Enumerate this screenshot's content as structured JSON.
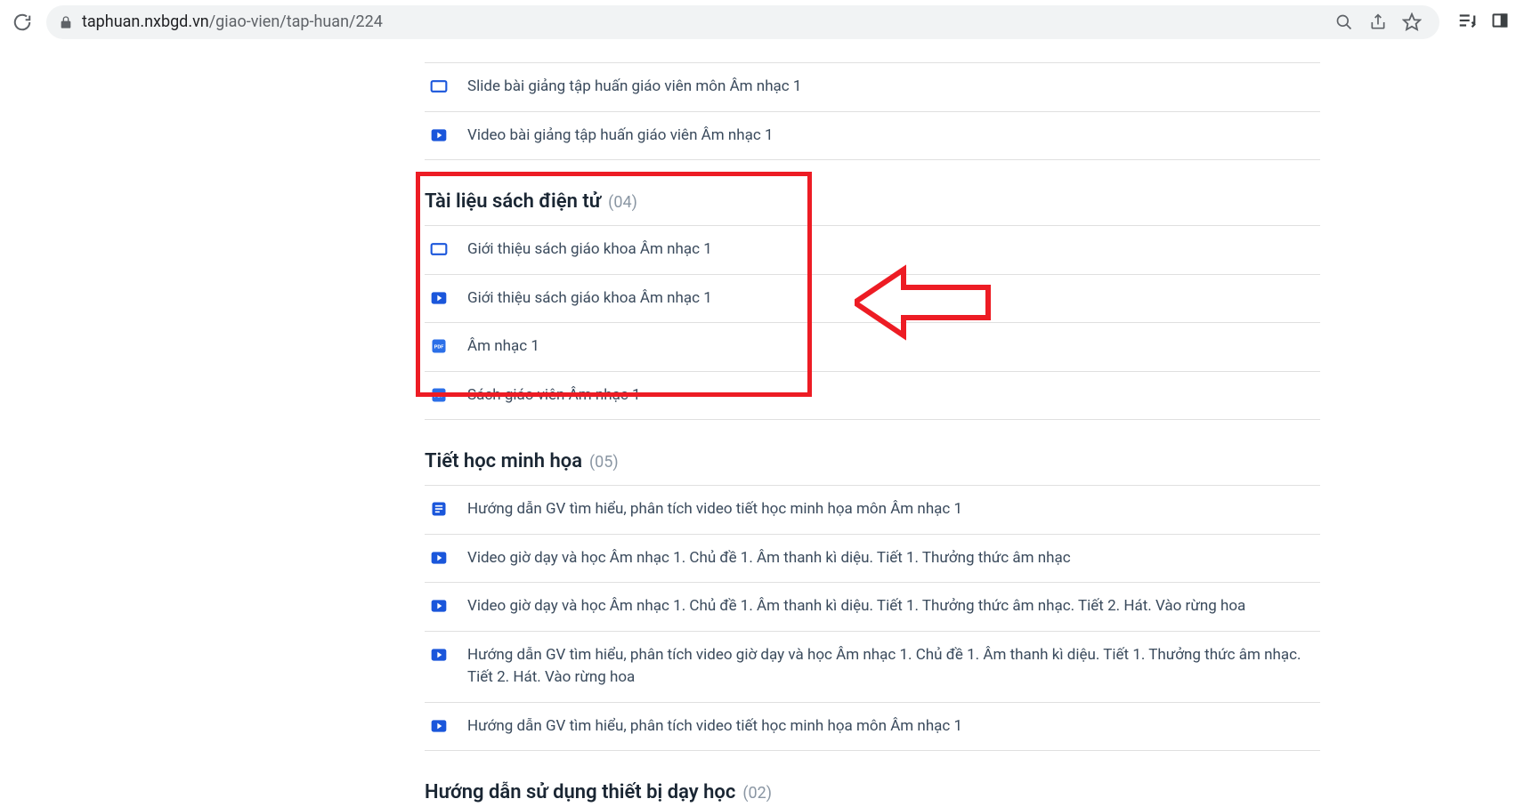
{
  "browser": {
    "url_host": "taphuan.nxbgd.vn",
    "url_path": "/giao-vien/tap-huan/224"
  },
  "sections": {
    "preamble": [
      {
        "icon": "slide",
        "label": "Slide bài giảng tập huấn giáo viên môn Âm nhạc 1"
      },
      {
        "icon": "video",
        "label": "Video bài giảng tập huấn giáo viên Âm nhạc 1"
      }
    ],
    "s1": {
      "title": "Tài liệu sách điện tử",
      "count": "(04)",
      "items": [
        {
          "icon": "slide",
          "label": "Giới thiệu sách giáo khoa Âm nhạc 1"
        },
        {
          "icon": "video",
          "label": "Giới thiệu sách giáo khoa Âm nhạc 1"
        },
        {
          "icon": "pdf",
          "label": "Âm nhạc 1"
        },
        {
          "icon": "pdf",
          "label": "Sách giáo viên Âm nhạc 1"
        }
      ]
    },
    "s2": {
      "title": "Tiết học minh họa",
      "count": "(05)",
      "items": [
        {
          "icon": "doc",
          "label": "Hướng dẫn GV tìm hiểu, phân tích video tiết học minh họa môn Âm nhạc 1"
        },
        {
          "icon": "video",
          "label": "Video giờ dạy và học Âm nhạc 1. Chủ đề 1. Âm thanh kì diệu. Tiết 1. Thưởng thức âm nhạc"
        },
        {
          "icon": "video",
          "label": "Video giờ dạy và học Âm nhạc 1. Chủ đề 1. Âm thanh kì diệu. Tiết 1. Thưởng thức âm nhạc. Tiết 2. Hát. Vào rừng hoa"
        },
        {
          "icon": "video",
          "label": "Hướng dẫn GV tìm hiểu, phân tích video giờ dạy và học Âm nhạc 1. Chủ đề 1. Âm thanh kì diệu. Tiết 1. Thưởng thức âm nhạc. Tiết 2. Hát. Vào rừng hoa"
        },
        {
          "icon": "video",
          "label": "Hướng dẫn GV tìm hiểu, phân tích video tiết học minh họa môn Âm nhạc 1"
        }
      ]
    },
    "s3": {
      "title": "Hướng dẫn sử dụng thiết bị dạy học",
      "count": "(02)"
    }
  }
}
